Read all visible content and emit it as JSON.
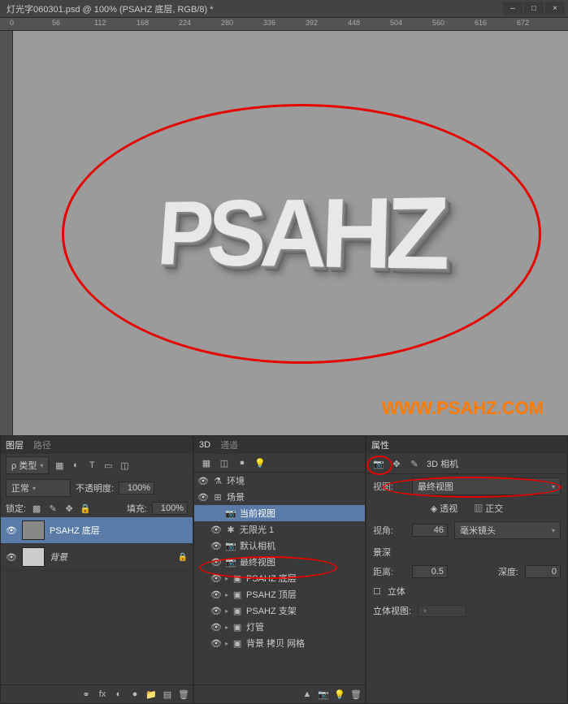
{
  "titlebar": {
    "title": "灯光字060301.psd @ 100% (PSAHZ 底层, RGB/8) *"
  },
  "ruler_marks": [
    0,
    56,
    112,
    168,
    224,
    280,
    336,
    392,
    448,
    504,
    560,
    616,
    672
  ],
  "canvas": {
    "text": "PSAHZ",
    "watermark": "WWW.PSAHZ.COM"
  },
  "layers_panel": {
    "tabs": [
      "图层",
      "路径"
    ],
    "filter_label": "ρ 类型",
    "blend_mode": "正常",
    "opacity_label": "不透明度:",
    "opacity_value": "100%",
    "lock_label": "锁定:",
    "fill_label": "填充:",
    "fill_value": "100%",
    "layers": [
      {
        "name": "PSAHZ 底层",
        "visible": true,
        "selected": true
      },
      {
        "name": "背景",
        "visible": true,
        "locked": true
      }
    ]
  },
  "panel_3d": {
    "tabs": [
      "3D",
      "通道"
    ],
    "items": [
      {
        "icon": "filter",
        "label": "环境",
        "indent": 0,
        "vis": true
      },
      {
        "icon": "scene",
        "label": "场景",
        "indent": 0,
        "vis": true
      },
      {
        "icon": "camera",
        "label": "当前视图",
        "indent": 1,
        "vis": true,
        "selected": true
      },
      {
        "icon": "light",
        "label": "无限光 1",
        "indent": 1,
        "vis": true
      },
      {
        "icon": "camera",
        "label": "默认相机",
        "indent": 1,
        "vis": true
      },
      {
        "icon": "camera",
        "label": "最终视图",
        "indent": 1,
        "vis": true,
        "highlight": true
      },
      {
        "icon": "mesh",
        "label": "PSAHZ 底层",
        "indent": 1,
        "vis": true,
        "expand": true
      },
      {
        "icon": "mesh",
        "label": "PSAHZ 顶层",
        "indent": 1,
        "vis": true,
        "expand": true
      },
      {
        "icon": "mesh",
        "label": "PSAHZ 支架",
        "indent": 1,
        "vis": true,
        "expand": true
      },
      {
        "icon": "mesh",
        "label": "灯管",
        "indent": 1,
        "vis": true,
        "expand": true
      },
      {
        "icon": "mesh",
        "label": "背景 拷贝 网格",
        "indent": 1,
        "vis": true,
        "expand": true
      }
    ]
  },
  "props_panel": {
    "tab": "属性",
    "header": "3D 相机",
    "view_label": "视图:",
    "view_value": "最终视图",
    "perspective": "透视",
    "ortho": "正交",
    "fov_label": "视角:",
    "fov_value": "46",
    "lens_value": "毫米镜头",
    "dof_label": "景深",
    "distance_label": "距离:",
    "distance_value": "0.5",
    "depth_label": "深度:",
    "depth_value": "0",
    "stereo_label": "立体",
    "stereo_view_label": "立体视图:"
  }
}
